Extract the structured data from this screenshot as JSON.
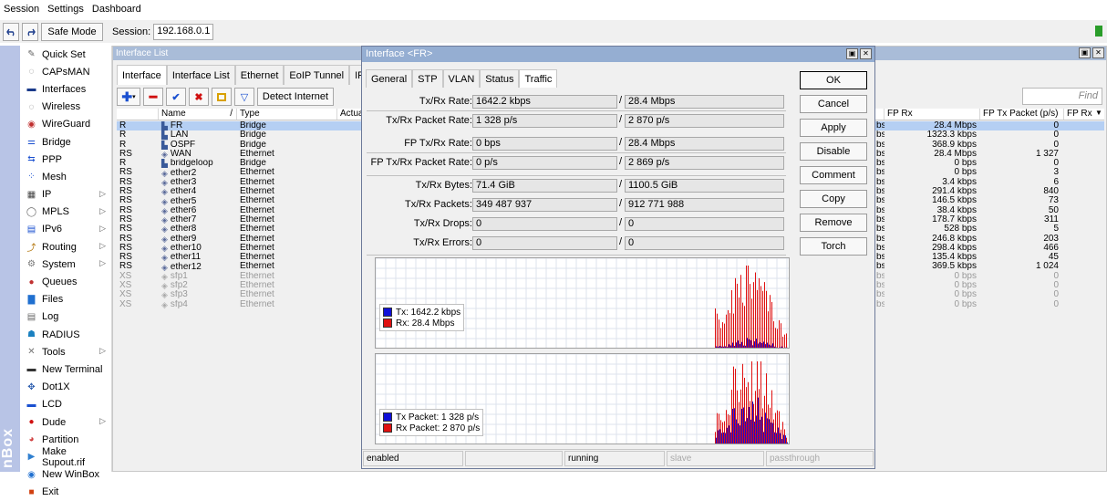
{
  "menubar": [
    "Session",
    "Settings",
    "Dashboard"
  ],
  "toolbar": {
    "undo_icon": "undo-icon",
    "redo_icon": "redo-icon",
    "safe_mode_label": "Safe Mode",
    "session_label": "Session:",
    "session_value": "192.168.0.1",
    "indicator_color": "#2a9d2a"
  },
  "brand_text": "nBox",
  "sidebar": [
    {
      "label": "Quick Set",
      "icon": "wand-icon",
      "arrow": false
    },
    {
      "label": "CAPsMAN",
      "icon": "wifi-icon",
      "arrow": false
    },
    {
      "label": "Interfaces",
      "icon": "interfaces-icon",
      "arrow": false
    },
    {
      "label": "Wireless",
      "icon": "wireless-icon",
      "arrow": false
    },
    {
      "label": "WireGuard",
      "icon": "wireguard-icon",
      "arrow": false
    },
    {
      "label": "Bridge",
      "icon": "bridge-icon",
      "arrow": false
    },
    {
      "label": "PPP",
      "icon": "ppp-icon",
      "arrow": false
    },
    {
      "label": "Mesh",
      "icon": "mesh-icon",
      "arrow": false
    },
    {
      "label": "IP",
      "icon": "ip-icon",
      "arrow": true
    },
    {
      "label": "MPLS",
      "icon": "mpls-icon",
      "arrow": true
    },
    {
      "label": "IPv6",
      "icon": "ipv6-icon",
      "arrow": true
    },
    {
      "label": "Routing",
      "icon": "routing-icon",
      "arrow": true
    },
    {
      "label": "System",
      "icon": "system-icon",
      "arrow": true
    },
    {
      "label": "Queues",
      "icon": "queues-icon",
      "arrow": false
    },
    {
      "label": "Files",
      "icon": "folder-icon",
      "arrow": false
    },
    {
      "label": "Log",
      "icon": "log-icon",
      "arrow": false
    },
    {
      "label": "RADIUS",
      "icon": "radius-icon",
      "arrow": false
    },
    {
      "label": "Tools",
      "icon": "tools-icon",
      "arrow": true
    },
    {
      "label": "New Terminal",
      "icon": "terminal-icon",
      "arrow": false
    },
    {
      "label": "Dot1X",
      "icon": "dot1x-icon",
      "arrow": false
    },
    {
      "label": "LCD",
      "icon": "lcd-icon",
      "arrow": false
    },
    {
      "label": "Dude",
      "icon": "dude-icon",
      "arrow": true
    },
    {
      "label": "Partition",
      "icon": "partition-icon",
      "arrow": false
    },
    {
      "label": "Make Supout.rif",
      "icon": "supout-icon",
      "arrow": false
    },
    {
      "label": "New WinBox",
      "icon": "winbox-icon",
      "arrow": false
    },
    {
      "label": "Exit",
      "icon": "exit-icon",
      "arrow": false
    }
  ],
  "interface_list": {
    "title": "Interface List",
    "tabs": [
      "Interface",
      "Interface List",
      "Ethernet",
      "EoIP Tunnel",
      "IP Tunn"
    ],
    "detect_label": "Detect Internet",
    "find_placeholder": "Find",
    "columns_left": [
      "",
      "Name",
      "/",
      "Type",
      "Actual"
    ],
    "columns_right": [
      "",
      "FP Rx",
      "FP Tx Packet (p/s)",
      "FP Rx F"
    ],
    "rows": [
      {
        "flag": "R",
        "name": "FR",
        "type": "Bridge",
        "rate_suffix": "bs",
        "fp_rx": "28.4 Mbps",
        "fp_tx_packet": "0",
        "selected": true,
        "disabled": false,
        "icon": "bridge-icon"
      },
      {
        "flag": "R",
        "name": "LAN",
        "type": "Bridge",
        "rate_suffix": "bs",
        "fp_rx": "1323.3 kbps",
        "fp_tx_packet": "0",
        "selected": false,
        "disabled": false,
        "icon": "bridge-icon"
      },
      {
        "flag": "R",
        "name": "OSPF",
        "type": "Bridge",
        "rate_suffix": "bs",
        "fp_rx": "368.9 kbps",
        "fp_tx_packet": "0",
        "selected": false,
        "disabled": false,
        "icon": "bridge-icon"
      },
      {
        "flag": "RS",
        "name": "WAN",
        "type": "Ethernet",
        "rate_suffix": "bs",
        "fp_rx": "28.4 Mbps",
        "fp_tx_packet": "1 327",
        "selected": false,
        "disabled": false,
        "icon": "ethernet-icon"
      },
      {
        "flag": "R",
        "name": "bridgeloop",
        "type": "Bridge",
        "rate_suffix": "bs",
        "fp_rx": "0 bps",
        "fp_tx_packet": "0",
        "selected": false,
        "disabled": false,
        "icon": "bridge-icon"
      },
      {
        "flag": "RS",
        "name": "ether2",
        "type": "Ethernet",
        "rate_suffix": "bs",
        "fp_rx": "0 bps",
        "fp_tx_packet": "3",
        "selected": false,
        "disabled": false,
        "icon": "ethernet-icon"
      },
      {
        "flag": "RS",
        "name": "ether3",
        "type": "Ethernet",
        "rate_suffix": "bs",
        "fp_rx": "3.4 kbps",
        "fp_tx_packet": "6",
        "selected": false,
        "disabled": false,
        "icon": "ethernet-icon"
      },
      {
        "flag": "RS",
        "name": "ether4",
        "type": "Ethernet",
        "rate_suffix": "bs",
        "fp_rx": "291.4 kbps",
        "fp_tx_packet": "840",
        "selected": false,
        "disabled": false,
        "icon": "ethernet-icon"
      },
      {
        "flag": "RS",
        "name": "ether5",
        "type": "Ethernet",
        "rate_suffix": "bs",
        "fp_rx": "146.5 kbps",
        "fp_tx_packet": "73",
        "selected": false,
        "disabled": false,
        "icon": "ethernet-icon"
      },
      {
        "flag": "RS",
        "name": "ether6",
        "type": "Ethernet",
        "rate_suffix": "bs",
        "fp_rx": "38.4 kbps",
        "fp_tx_packet": "50",
        "selected": false,
        "disabled": false,
        "icon": "ethernet-icon"
      },
      {
        "flag": "RS",
        "name": "ether7",
        "type": "Ethernet",
        "rate_suffix": "bs",
        "fp_rx": "178.7 kbps",
        "fp_tx_packet": "311",
        "selected": false,
        "disabled": false,
        "icon": "ethernet-icon"
      },
      {
        "flag": "RS",
        "name": "ether8",
        "type": "Ethernet",
        "rate_suffix": "bs",
        "fp_rx": "528 bps",
        "fp_tx_packet": "5",
        "selected": false,
        "disabled": false,
        "icon": "ethernet-icon"
      },
      {
        "flag": "RS",
        "name": "ether9",
        "type": "Ethernet",
        "rate_suffix": "bs",
        "fp_rx": "246.8 kbps",
        "fp_tx_packet": "203",
        "selected": false,
        "disabled": false,
        "icon": "ethernet-icon"
      },
      {
        "flag": "RS",
        "name": "ether10",
        "type": "Ethernet",
        "rate_suffix": "bs",
        "fp_rx": "298.4 kbps",
        "fp_tx_packet": "466",
        "selected": false,
        "disabled": false,
        "icon": "ethernet-icon"
      },
      {
        "flag": "RS",
        "name": "ether11",
        "type": "Ethernet",
        "rate_suffix": "bs",
        "fp_rx": "135.4 kbps",
        "fp_tx_packet": "45",
        "selected": false,
        "disabled": false,
        "icon": "ethernet-icon"
      },
      {
        "flag": "RS",
        "name": "ether12",
        "type": "Ethernet",
        "rate_suffix": "bs",
        "fp_rx": "369.5 kbps",
        "fp_tx_packet": "1 024",
        "selected": false,
        "disabled": false,
        "icon": "ethernet-icon"
      },
      {
        "flag": "XS",
        "name": "sfp1",
        "type": "Ethernet",
        "rate_suffix": "bs",
        "fp_rx": "0 bps",
        "fp_tx_packet": "0",
        "selected": false,
        "disabled": true,
        "icon": "ethernet-icon"
      },
      {
        "flag": "XS",
        "name": "sfp2",
        "type": "Ethernet",
        "rate_suffix": "bs",
        "fp_rx": "0 bps",
        "fp_tx_packet": "0",
        "selected": false,
        "disabled": true,
        "icon": "ethernet-icon"
      },
      {
        "flag": "XS",
        "name": "sfp3",
        "type": "Ethernet",
        "rate_suffix": "bs",
        "fp_rx": "0 bps",
        "fp_tx_packet": "0",
        "selected": false,
        "disabled": true,
        "icon": "ethernet-icon"
      },
      {
        "flag": "XS",
        "name": "sfp4",
        "type": "Ethernet",
        "rate_suffix": "bs",
        "fp_rx": "0 bps",
        "fp_tx_packet": "0",
        "selected": false,
        "disabled": true,
        "icon": "ethernet-icon"
      }
    ]
  },
  "dialog": {
    "title": "Interface <FR>",
    "tabs": [
      "General",
      "STP",
      "VLAN",
      "Status",
      "Traffic"
    ],
    "active_tab": "Traffic",
    "fields": [
      {
        "label": "Tx/Rx Rate:",
        "tx": "1642.2 kbps",
        "rx": "28.4 Mbps"
      },
      {
        "label": "Tx/Rx Packet Rate:",
        "tx": "1 328 p/s",
        "rx": "2 870 p/s"
      },
      {
        "label": "FP Tx/Rx Rate:",
        "tx": "0 bps",
        "rx": "28.4 Mbps"
      },
      {
        "label": "FP Tx/Rx Packet Rate:",
        "tx": "0 p/s",
        "rx": "2 869 p/s"
      },
      {
        "label": "Tx/Rx Bytes:",
        "tx": "71.4 GiB",
        "rx": "1100.5 GiB"
      },
      {
        "label": "Tx/Rx Packets:",
        "tx": "349 487 937",
        "rx": "912 771 988"
      },
      {
        "label": "Tx/Rx Drops:",
        "tx": "0",
        "rx": "0"
      },
      {
        "label": "Tx/Rx Errors:",
        "tx": "0",
        "rx": "0"
      }
    ],
    "separator": "/",
    "graph1": {
      "tx_label": "Tx:  1642.2 kbps",
      "rx_label": "Rx:  28.4 Mbps",
      "tx_color": "#1010d8",
      "rx_color": "#e01010"
    },
    "graph2": {
      "tx_label": "Tx Packet:  1 328 p/s",
      "rx_label": "Rx Packet:  2 870 p/s",
      "tx_color": "#1010d8",
      "rx_color": "#e01010"
    },
    "buttons": [
      "OK",
      "Cancel",
      "Apply",
      "Disable",
      "Comment",
      "Copy",
      "Remove",
      "Torch"
    ],
    "status": [
      "enabled",
      "",
      "running",
      "slave",
      "passthrough"
    ]
  }
}
